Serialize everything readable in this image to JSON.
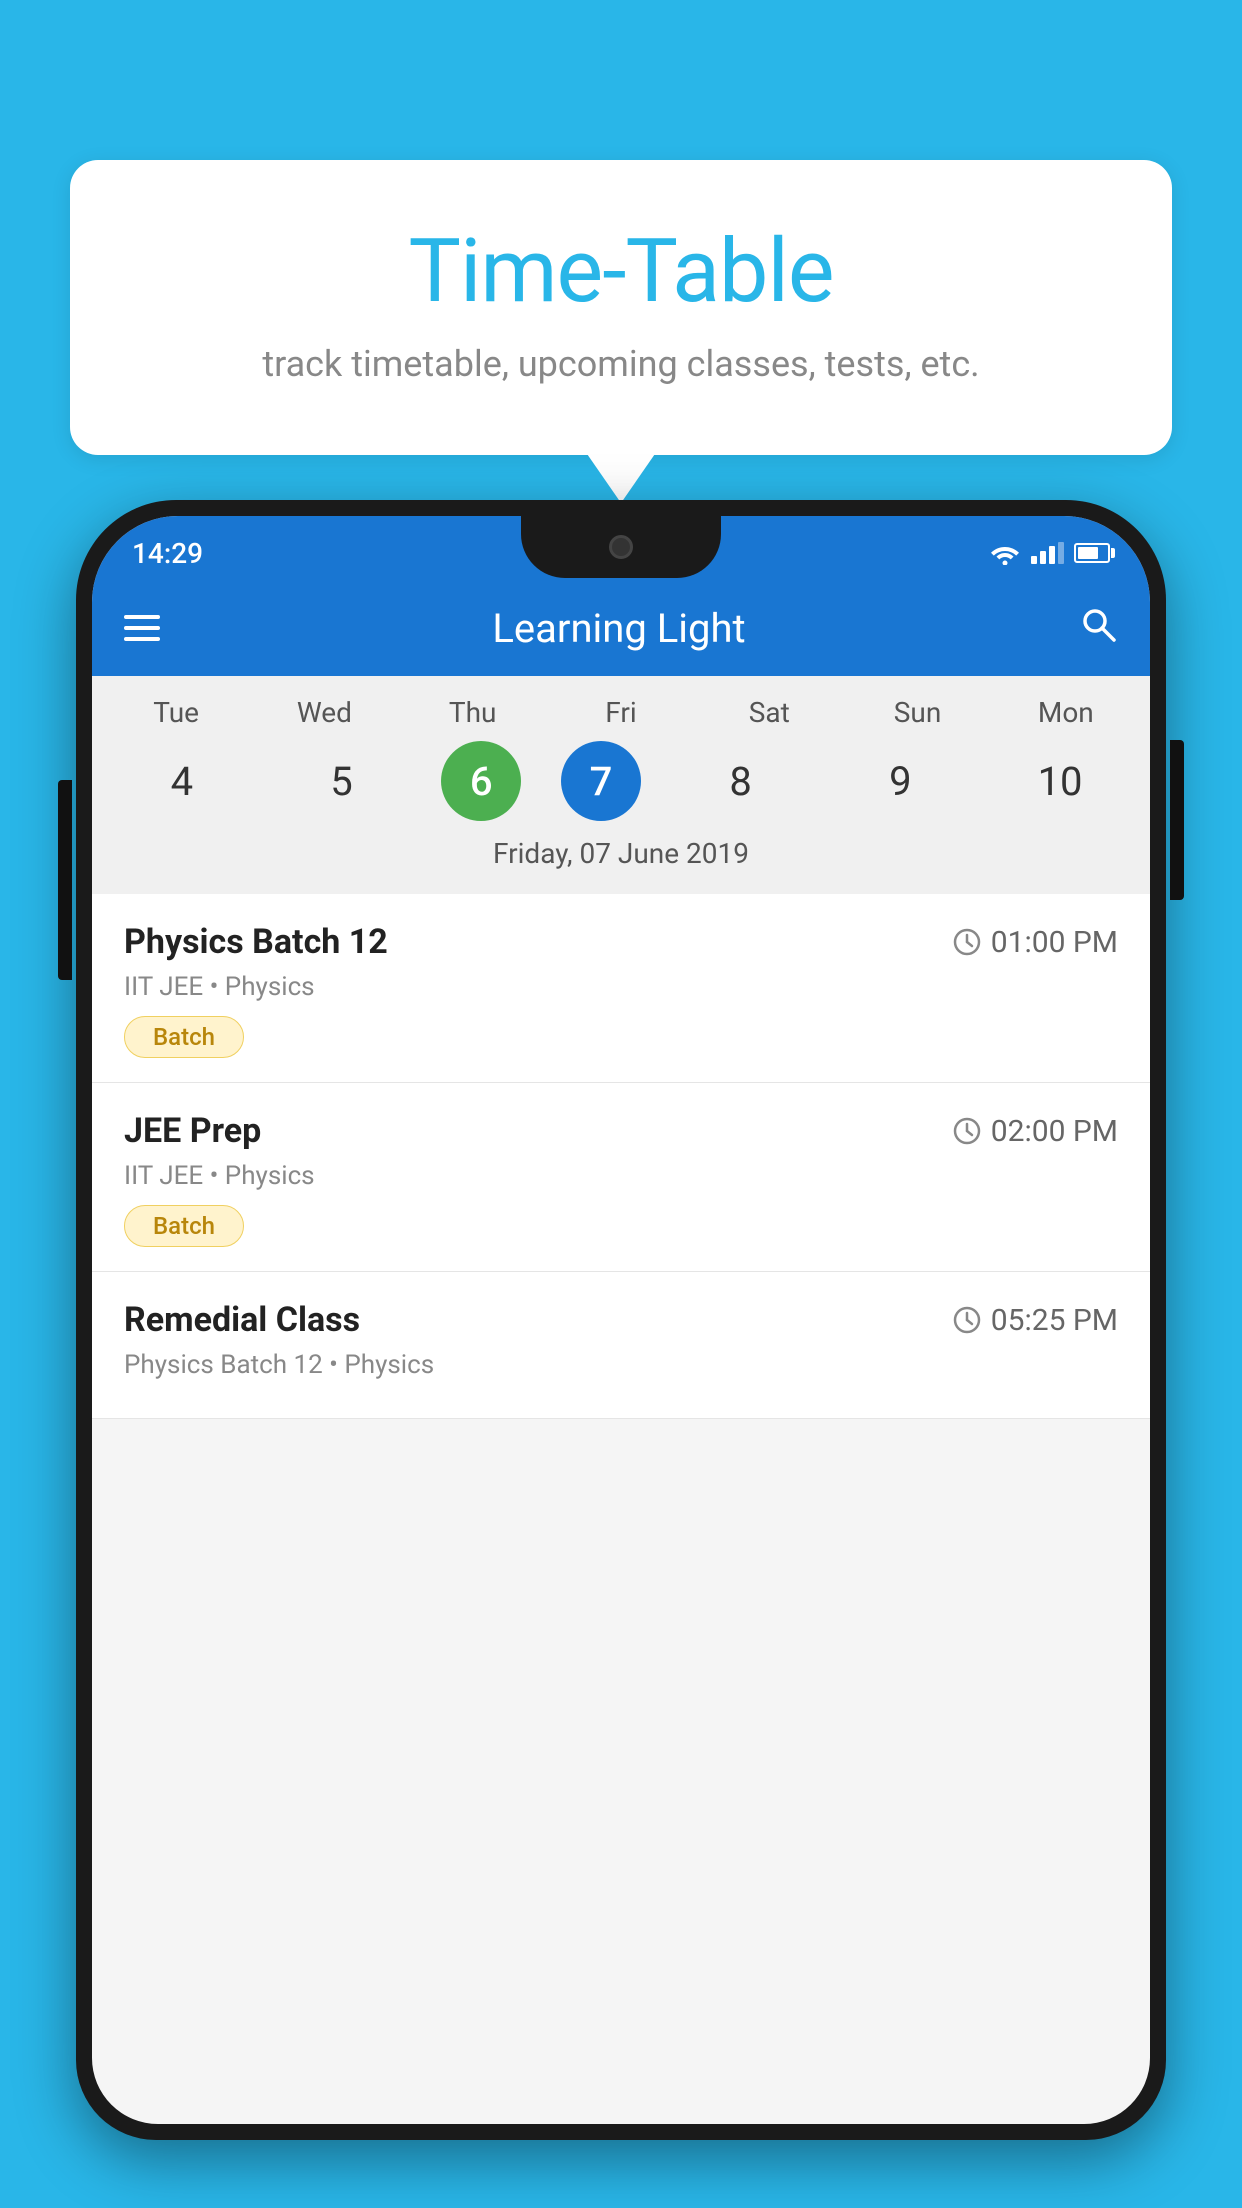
{
  "background_color": "#29B6E8",
  "header": {
    "title": "Time-Table",
    "subtitle": "track timetable, upcoming classes, tests, etc."
  },
  "phone": {
    "status_bar": {
      "time": "14:29"
    },
    "app_bar": {
      "title": "Learning Light"
    },
    "calendar": {
      "days": [
        {
          "name": "Tue",
          "number": "4",
          "state": "normal"
        },
        {
          "name": "Wed",
          "number": "5",
          "state": "normal"
        },
        {
          "name": "Thu",
          "number": "6",
          "state": "today"
        },
        {
          "name": "Fri",
          "number": "7",
          "state": "selected"
        },
        {
          "name": "Sat",
          "number": "8",
          "state": "normal"
        },
        {
          "name": "Sun",
          "number": "9",
          "state": "normal"
        },
        {
          "name": "Mon",
          "number": "10",
          "state": "normal"
        }
      ],
      "selected_date": "Friday, 07 June 2019"
    },
    "schedule": [
      {
        "title": "Physics Batch 12",
        "time": "01:00 PM",
        "meta": "IIT JEE • Physics",
        "badge": "Batch"
      },
      {
        "title": "JEE Prep",
        "time": "02:00 PM",
        "meta": "IIT JEE • Physics",
        "badge": "Batch"
      },
      {
        "title": "Remedial Class",
        "time": "05:25 PM",
        "meta": "Physics Batch 12 • Physics",
        "badge": ""
      }
    ]
  }
}
